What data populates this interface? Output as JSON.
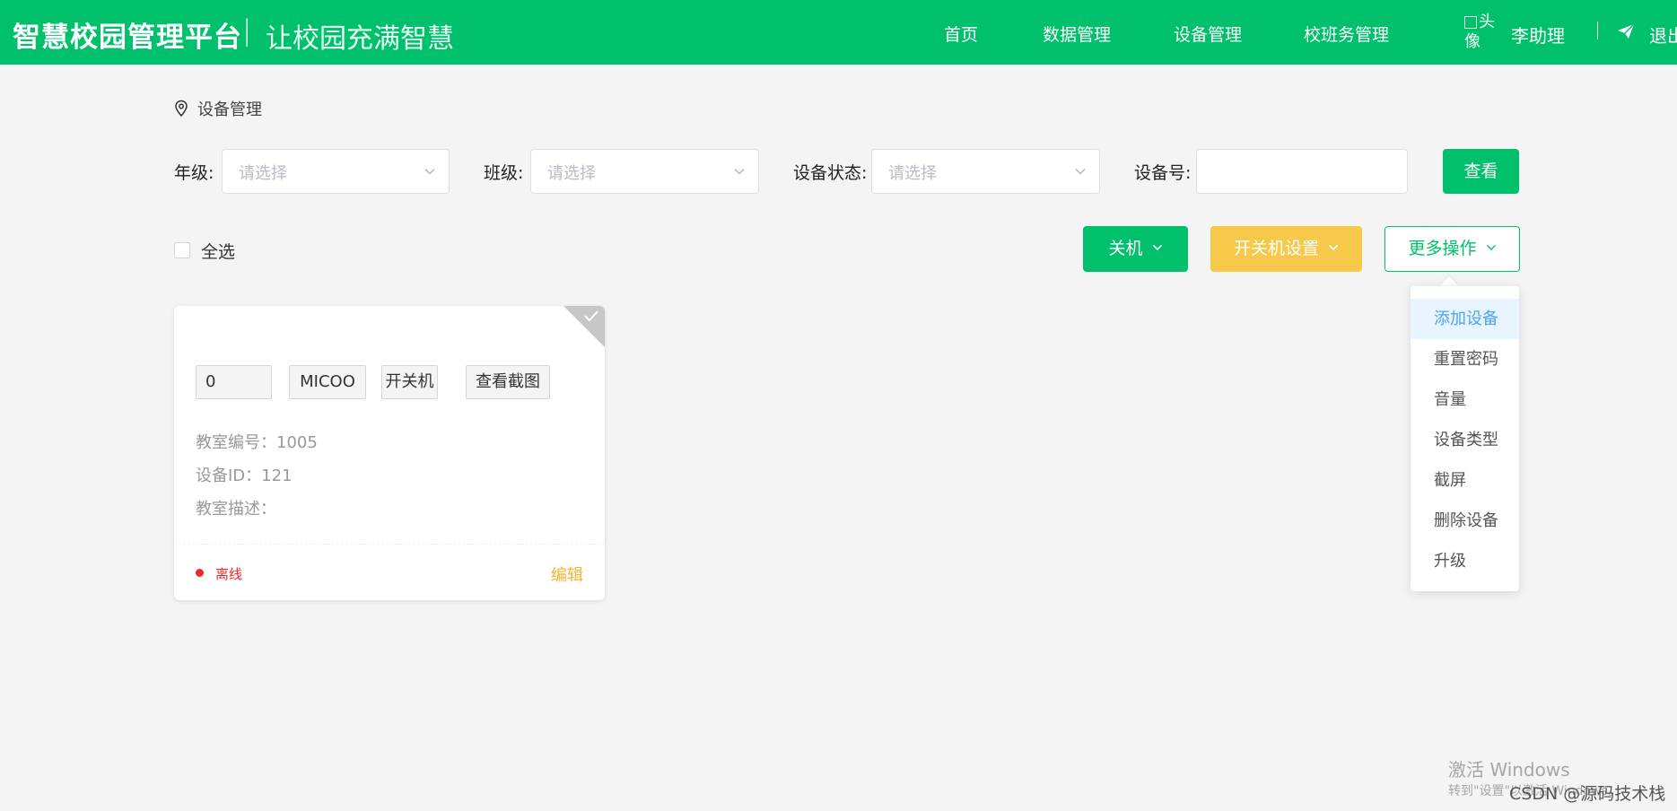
{
  "header": {
    "brand": "智慧校园管理平台",
    "separator": "|",
    "slogan": "让校园充满智慧",
    "nav": [
      "首页",
      "数据管理",
      "设备管理",
      "校班务管理"
    ],
    "avatar_alt": "头像",
    "username": "李助理",
    "logout": "退出",
    "colors": {
      "primary": "#00c06c"
    }
  },
  "breadcrumb": {
    "icon": "location-pin-icon",
    "label": "设备管理"
  },
  "filters": {
    "grade_label": "年级:",
    "grade_placeholder": "请选择",
    "class_label": "班级:",
    "class_placeholder": "请选择",
    "status_label": "设备状态:",
    "status_placeholder": "请选择",
    "device_no_label": "设备号:",
    "device_no_value": "",
    "query_button": "查看"
  },
  "toolbar": {
    "select_all": "全选",
    "shutdown": "关机",
    "schedule": "开关机设置",
    "more": "更多操作"
  },
  "more_menu": {
    "items": [
      "添加设备",
      "重置密码",
      "音量",
      "设备类型",
      "截屏",
      "删除设备",
      "升级"
    ],
    "active_index": 0
  },
  "device_card": {
    "chips": [
      "0",
      "MICOO",
      "开关机",
      "查看截图"
    ],
    "classroom_no": "教室编号：1005",
    "device_id": "设备ID：121",
    "description": "教室描述：",
    "status": "离线",
    "status_color": "#f0262d",
    "edit": "编辑"
  },
  "watermark": {
    "activate": "激活 Windows",
    "activate_sub": "转到\"设置\"以激活 Windows。",
    "source": "CSDN @源码技术栈"
  }
}
